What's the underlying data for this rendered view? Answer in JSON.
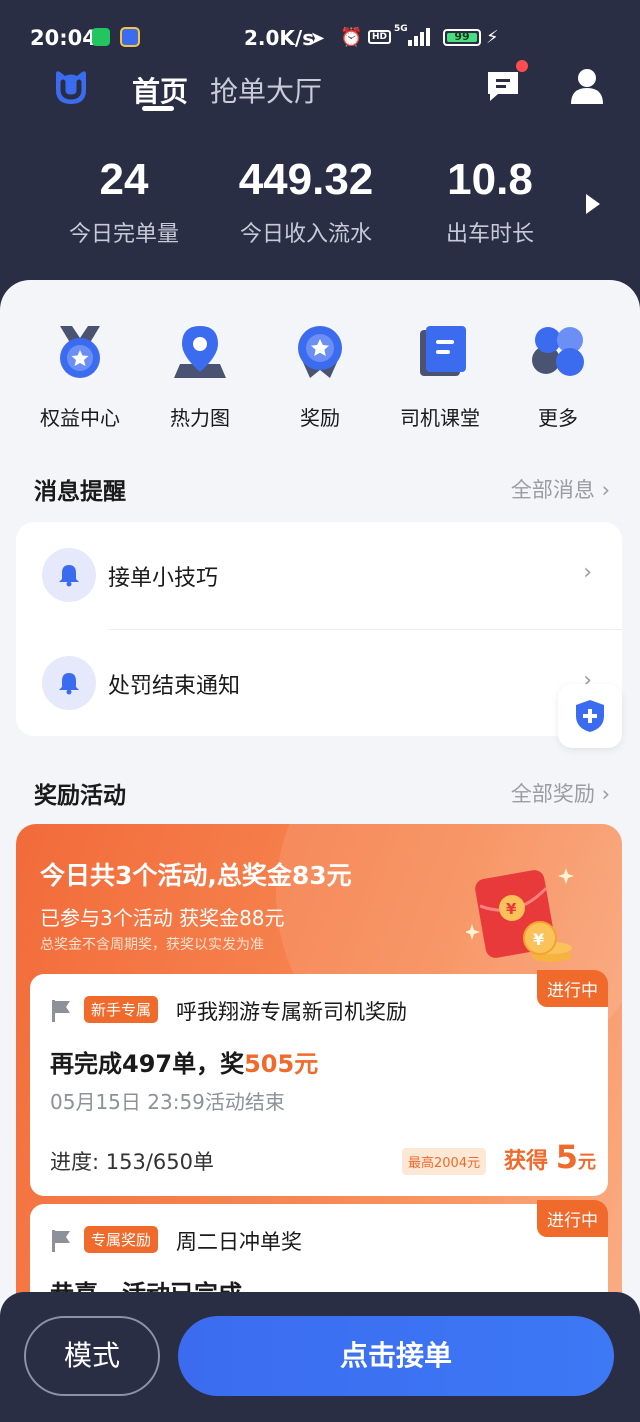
{
  "status_bar": {
    "time": "20:04",
    "network_speed": "2.0K/s",
    "hd": "HD",
    "net_type": "5G",
    "battery": "99",
    "battery_fraction": 0.99
  },
  "header": {
    "tabs": [
      {
        "label": "首页",
        "active": true
      },
      {
        "label": "抢单大厅",
        "active": false
      }
    ]
  },
  "stats": [
    {
      "value": "24",
      "label": "今日完单量"
    },
    {
      "value": "449.32",
      "label": "今日收入流水"
    },
    {
      "value": "10.8",
      "label": "出车时长"
    }
  ],
  "quick_actions": [
    {
      "label": "权益中心",
      "icon": "medal-icon"
    },
    {
      "label": "热力图",
      "icon": "map-pin-icon"
    },
    {
      "label": "奖励",
      "icon": "reward-badge-icon"
    },
    {
      "label": "司机课堂",
      "icon": "book-icon"
    },
    {
      "label": "更多",
      "icon": "more-grid-icon"
    }
  ],
  "messages_section": {
    "title": "消息提醒",
    "more": "全部消息",
    "items": [
      {
        "text": "接单小技巧"
      },
      {
        "text": "处罚结束通知"
      }
    ]
  },
  "rewards_section": {
    "title": "奖励活动",
    "more": "全部奖励",
    "summary_title": "今日共3个活动,总奖金83元",
    "summary_sub": "已参与3个活动 获奖金88元",
    "summary_note": "总奖金不含周期奖，获奖以实发为准",
    "activities": [
      {
        "status": "进行中",
        "tag": "新手专属",
        "title": "呼我翔游专属新司机奖励",
        "goal_prefix": "再完成497单，奖",
        "goal_amount": "505元",
        "end_time": "05月15日 23:59活动结束",
        "progress": "进度: 153/650单",
        "max_label": "最高2004元",
        "earn_prefix": "获得",
        "earn_value": "5",
        "earn_unit": "元"
      },
      {
        "status": "进行中",
        "tag": "专属奖励",
        "title": "周二日冲单奖",
        "goal_prefix": "恭喜，活动已完成",
        "goal_amount": ""
      }
    ]
  },
  "bottom": {
    "mode_label": "模式",
    "go_label": "点击接单"
  },
  "colors": {
    "header_bg": "#2a2e45",
    "accent_orange": "#f06a2c",
    "primary_blue": "#3b6cf0",
    "panel_bg": "#f4f5f8"
  }
}
